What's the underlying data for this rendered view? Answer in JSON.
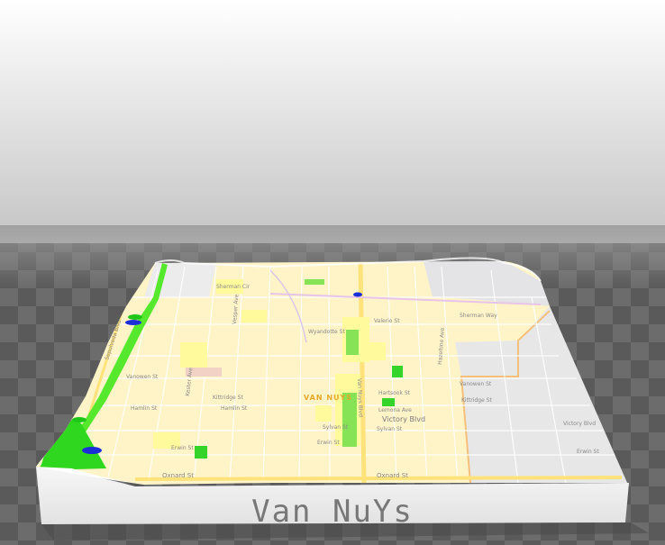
{
  "model_title": "Van NuYs",
  "map": {
    "area_label": "VAN NUYS",
    "boulevard_label": "Victory Blvd",
    "street_labels": [
      "Oxnard St",
      "Oxnard St",
      "Vanowen St",
      "Vanowen St",
      "Kittridge St",
      "Kittridge St",
      "Hamlin St",
      "Hamlin St",
      "Sylvan St",
      "Sylvan St",
      "Erwin St",
      "Erwin St",
      "Erwin St",
      "Victory Blvd",
      "Hartsook St",
      "Lemona Ave",
      "Sepulveda Blvd",
      "Kester Ave",
      "Vesper Ave",
      "Van Nuys Blvd",
      "Hazeltine Ave",
      "Sherman Way",
      "Valerio St",
      "Wyandotte St",
      "Sherman Cir"
    ]
  },
  "colors": {
    "floor_dark": "#555555",
    "floor_light": "#6e6e6e",
    "sky_top": "#ffffff",
    "land": "#fff3c8",
    "neighbor_land": "#e9e9ea",
    "park": "#35d42a",
    "water_marker": "#1a2fd6",
    "major_road": "#ffe98a",
    "label_orange": "#e3a92a",
    "base_side": "#f1f1f1"
  }
}
